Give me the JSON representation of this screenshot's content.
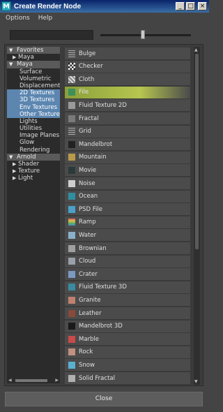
{
  "window": {
    "title": "Create Render Node",
    "icon_letter": "M"
  },
  "menu": [
    "Options",
    "Help"
  ],
  "tree": [
    {
      "label": "Favorites",
      "kind": "header"
    },
    {
      "label": "Maya",
      "kind": "sub"
    },
    {
      "label": "Maya",
      "kind": "header"
    },
    {
      "label": "Surface",
      "kind": "leaf"
    },
    {
      "label": "Volumetric",
      "kind": "leaf"
    },
    {
      "label": "Displacement",
      "kind": "leaf"
    },
    {
      "label": "2D Textures",
      "kind": "leaf",
      "selected": true
    },
    {
      "label": "3D Textures",
      "kind": "leaf",
      "selected": true
    },
    {
      "label": "Env Textures",
      "kind": "leaf",
      "selected": true
    },
    {
      "label": "Other Textures",
      "kind": "leaf",
      "selected": true
    },
    {
      "label": "Lights",
      "kind": "leaf"
    },
    {
      "label": "Utilities",
      "kind": "leaf"
    },
    {
      "label": "Image Planes",
      "kind": "leaf"
    },
    {
      "label": "Glow",
      "kind": "leaf"
    },
    {
      "label": "Rendering",
      "kind": "leaf"
    },
    {
      "label": "Arnold",
      "kind": "header"
    },
    {
      "label": "Shader",
      "kind": "sub"
    },
    {
      "label": "Texture",
      "kind": "sub"
    },
    {
      "label": "Light",
      "kind": "sub"
    }
  ],
  "nodes": [
    {
      "label": "Bulge",
      "icon": "bulge-icon",
      "color": "#8a8a8a"
    },
    {
      "label": "Checker",
      "icon": "checker-icon",
      "color": "#ffffff"
    },
    {
      "label": "Cloth",
      "icon": "cloth-icon",
      "color": "#b0b0b0"
    },
    {
      "label": "File",
      "icon": "file-icon",
      "color": "#3f8f5a",
      "highlight": true
    },
    {
      "label": "Fluid Texture 2D",
      "icon": "fluid-texture-2d-icon",
      "color": "#9a9a9a"
    },
    {
      "label": "Fractal",
      "icon": "fractal-icon",
      "color": "#7a7a7a"
    },
    {
      "label": "Grid",
      "icon": "grid-icon",
      "color": "#6a6a6a"
    },
    {
      "label": "Mandelbrot",
      "icon": "mandelbrot-icon",
      "color": "#222222"
    },
    {
      "label": "Mountain",
      "icon": "mountain-icon",
      "color": "#b89a4a"
    },
    {
      "label": "Movie",
      "icon": "movie-icon",
      "color": "#2a3a3a"
    },
    {
      "label": "Noise",
      "icon": "noise-icon",
      "color": "#cfcfcf"
    },
    {
      "label": "Ocean",
      "icon": "ocean-icon",
      "color": "#2f8fa0"
    },
    {
      "label": "PSD File",
      "icon": "psd-file-icon",
      "color": "#4aa0c8"
    },
    {
      "label": "Ramp",
      "icon": "ramp-icon",
      "color": "#d65a5a"
    },
    {
      "label": "Water",
      "icon": "water-icon",
      "color": "#8ab0c8"
    },
    {
      "label": "Brownian",
      "icon": "brownian-icon",
      "color": "#a0a0a0"
    },
    {
      "label": "Cloud",
      "icon": "cloud-icon",
      "color": "#9aa0a8"
    },
    {
      "label": "Crater",
      "icon": "crater-icon",
      "color": "#7a9ac0"
    },
    {
      "label": "Fluid Texture 3D",
      "icon": "fluid-texture-3d-icon",
      "color": "#3a8aa0"
    },
    {
      "label": "Granite",
      "icon": "granite-icon",
      "color": "#c08070"
    },
    {
      "label": "Leather",
      "icon": "leather-icon",
      "color": "#8a4a3a"
    },
    {
      "label": "Mandelbrot 3D",
      "icon": "mandelbrot-3d-icon",
      "color": "#1a1a1a"
    },
    {
      "label": "Marble",
      "icon": "marble-icon",
      "color": "#c84a4a"
    },
    {
      "label": "Rock",
      "icon": "rock-icon",
      "color": "#c09080"
    },
    {
      "label": "Snow",
      "icon": "snow-icon",
      "color": "#5ab0d0"
    },
    {
      "label": "Solid Fractal",
      "icon": "solid-fractal-icon",
      "color": "#b0b0b0"
    }
  ],
  "close_label": "Close"
}
